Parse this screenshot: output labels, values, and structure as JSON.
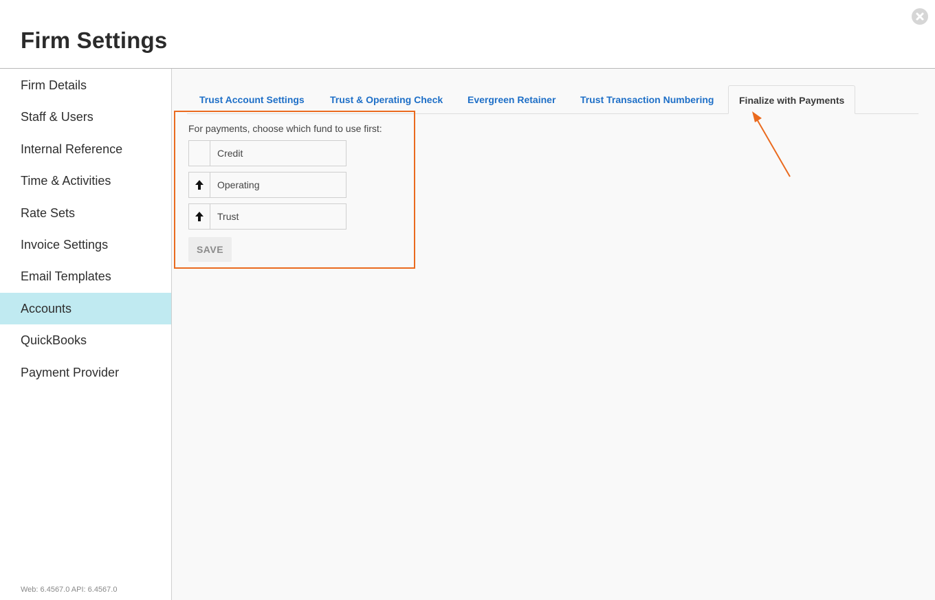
{
  "header": {
    "title": "Firm Settings",
    "close_icon": "close-circle-icon"
  },
  "sidebar": {
    "items": [
      {
        "label": "Firm Details"
      },
      {
        "label": "Staff & Users"
      },
      {
        "label": "Internal Reference"
      },
      {
        "label": "Time & Activities"
      },
      {
        "label": "Rate Sets"
      },
      {
        "label": "Invoice Settings"
      },
      {
        "label": "Email Templates"
      },
      {
        "label": "Accounts",
        "active": true
      },
      {
        "label": "QuickBooks"
      },
      {
        "label": "Payment Provider"
      }
    ],
    "version": "Web: 6.4567.0 API: 6.4567.0"
  },
  "tabs": [
    {
      "label": "Trust Account Settings"
    },
    {
      "label": "Trust & Operating Check"
    },
    {
      "label": "Evergreen Retainer"
    },
    {
      "label": "Trust Transaction Numbering"
    },
    {
      "label": "Finalize with Payments",
      "active": true
    }
  ],
  "payments": {
    "instruction": "For payments, choose which fund to use first:",
    "funds": [
      {
        "label": "Credit",
        "has_up_arrow": false
      },
      {
        "label": "Operating",
        "has_up_arrow": true
      },
      {
        "label": "Trust",
        "has_up_arrow": true
      }
    ],
    "save_label": "SAVE"
  },
  "colors": {
    "accent_active_bg": "#c0eaf1",
    "tab_link": "#1e6fc7",
    "annotation": "#ea6a1e"
  }
}
